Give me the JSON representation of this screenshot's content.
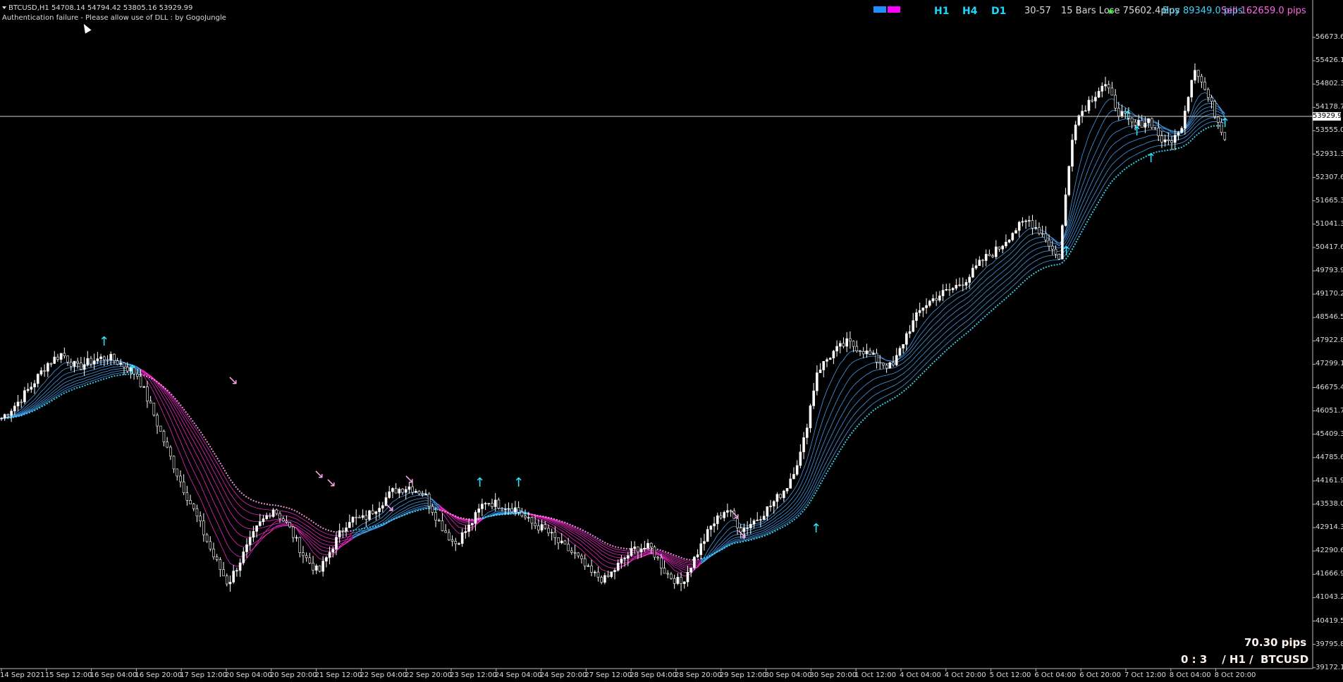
{
  "header": {
    "symbol_line": "BTCUSD,H1  54708.14 54794.42 53805.16 53929.99",
    "auth_message": "Authentication failure - Please allow use of DLL : by GogoJungle"
  },
  "top_right": {
    "timeframes": [
      "H1",
      "H4",
      "D1"
    ],
    "range": "30-57",
    "bars_lose": "15 Bars Lose 75602.4pips",
    "buy": "Buy 89349.0 pips",
    "sell": "Sell 162659.0 pips",
    "legend_colors": [
      "#1e90ff",
      "#ff00ff"
    ],
    "star_icon": "star-icon"
  },
  "price_axis": {
    "labels": [
      "56673.60",
      "55426.10",
      "54802.35",
      "54178.70",
      "53555.00",
      "52931.30",
      "52307.60",
      "51665.30",
      "51041.30",
      "50417.60",
      "49793.90",
      "49170.20",
      "48546.50",
      "47922.80",
      "47299.10",
      "46675.40",
      "46051.70",
      "45409.30",
      "44785.60",
      "44161.90",
      "43538.00",
      "42914.30",
      "42290.60",
      "41666.90",
      "41043.20",
      "40419.50",
      "39795.80",
      "39172.10"
    ],
    "current_price": "53929.99"
  },
  "time_axis": {
    "labels": [
      "14 Sep 2021",
      "15 Sep 12:00",
      "16 Sep 04:00",
      "16 Sep 20:00",
      "17 Sep 12:00",
      "20 Sep 04:00",
      "20 Sep 20:00",
      "21 Sep 12:00",
      "22 Sep 04:00",
      "22 Sep 20:00",
      "23 Sep 12:00",
      "24 Sep 04:00",
      "24 Sep 20:00",
      "27 Sep 12:00",
      "28 Sep 04:00",
      "28 Sep 20:00",
      "29 Sep 12:00",
      "30 Sep 04:00",
      "30 Sep 20:00",
      "1 Oct 12:00",
      "4 Oct 04:00",
      "4 Oct 20:00",
      "5 Oct 12:00",
      "6 Oct 04:00",
      "6 Oct 20:00",
      "7 Oct 12:00",
      "8 Oct 04:00",
      "8 Oct 20:00"
    ]
  },
  "bottom_right": {
    "pips": "70.30 pips",
    "score": "0 : 3    / H1 /  BTCUSD"
  },
  "colors": {
    "candle": "#ffffff",
    "bull_ribbon": "#4aa8ff",
    "bear_ribbon": "#ff2bd6",
    "up_arrow": "#2ee6ff",
    "down_arrow": "#ffa8ee"
  },
  "price_series": {
    "note_units": "USD",
    "close_path": [
      46100,
      46500,
      47000,
      47600,
      47900,
      47500,
      47700,
      47800,
      47600,
      47300,
      46300,
      45200,
      44200,
      43300,
      42300,
      41500,
      42300,
      43100,
      43600,
      43100,
      42300,
      41800,
      42600,
      43300,
      43300,
      43700,
      44100,
      44200,
      44000,
      43200,
      42600,
      43100,
      43800,
      43700,
      43600,
      43200,
      43000,
      42600,
      42300,
      41800,
      41600,
      42100,
      42500,
      42500,
      41800,
      41500,
      42300,
      43100,
      43600,
      43000,
      43300,
      43700,
      44200,
      45200,
      47400,
      47900,
      48200,
      48000,
      47700,
      47500,
      48500,
      49200,
      49500,
      49700,
      50000,
      50500,
      50800,
      51300,
      51600,
      51200,
      50500,
      54300,
      54900,
      55400,
      54600,
      54200,
      54400,
      53700,
      54000,
      55900,
      54900,
      53930
    ]
  }
}
